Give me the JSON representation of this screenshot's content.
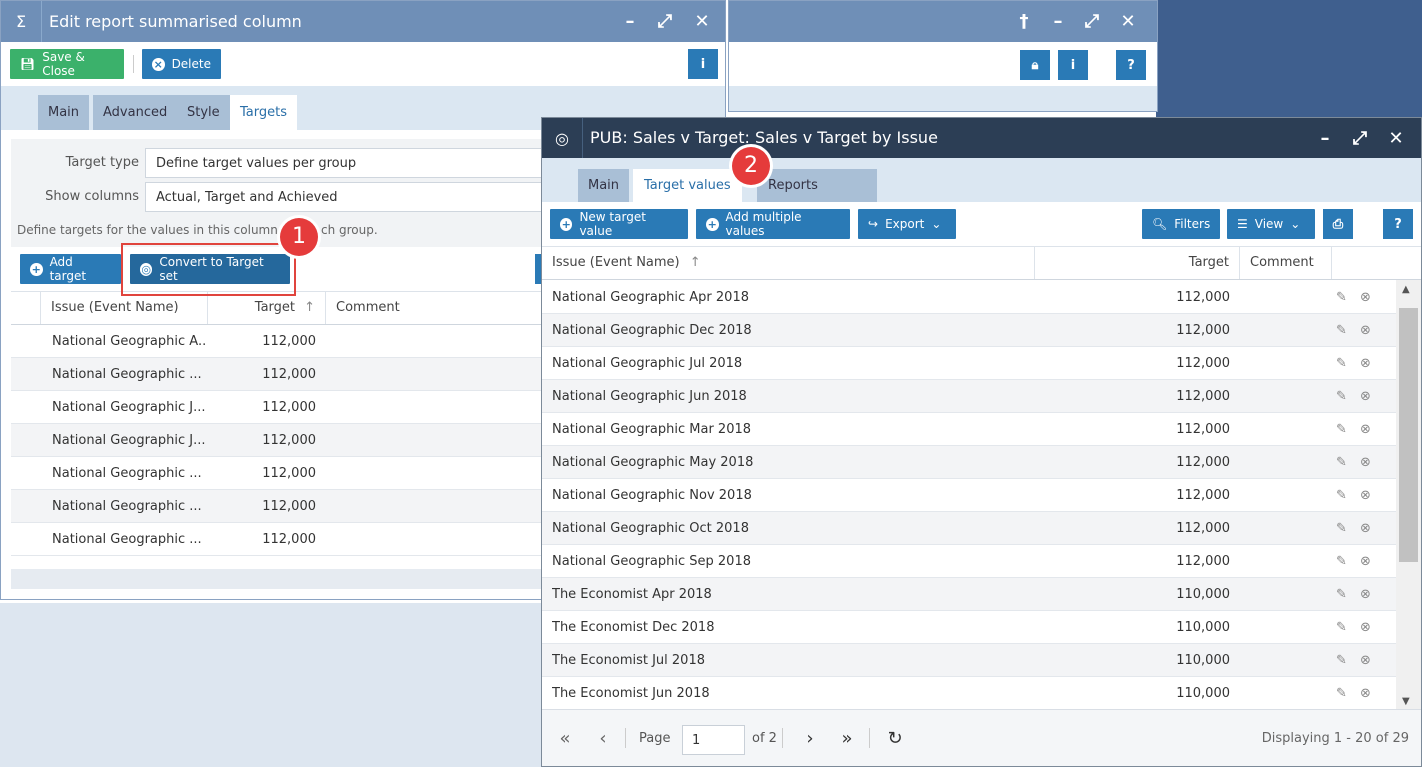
{
  "editor": {
    "title": "Edit report summarised column",
    "save_label": "Save & Close",
    "delete_label": "Delete",
    "tabs": [
      "Main",
      "Advanced",
      "Style",
      "Targets"
    ],
    "active_tab": "Targets",
    "target_type_label": "Target type",
    "target_type_value": "Define target values per group",
    "show_columns_label": "Show columns",
    "show_columns_value": "Actual, Target and Achieved",
    "hint": "Define targets for the values in this column wi",
    "hint_tail": "ch group.",
    "add_target_label": "Add target",
    "convert_label": "Convert to Target set",
    "columns": [
      "Issue (Event Name)",
      "Target",
      "Comment"
    ],
    "rows": [
      {
        "issue": "National Geographic A...",
        "target": "112,000"
      },
      {
        "issue": "National Geographic ...",
        "target": "112,000"
      },
      {
        "issue": "National Geographic J...",
        "target": "112,000"
      },
      {
        "issue": "National Geographic J...",
        "target": "112,000"
      },
      {
        "issue": "National Geographic ...",
        "target": "112,000"
      },
      {
        "issue": "National Geographic ...",
        "target": "112,000"
      },
      {
        "issue": "National Geographic ...",
        "target": "112,000"
      }
    ]
  },
  "targets": {
    "title": "PUB: Sales v Target: Sales v Target by Issue",
    "tabs": [
      "Main",
      "Target values",
      "Reports"
    ],
    "active_tab": "Target values",
    "new_label": "New target value",
    "add_multiple_label": "Add multiple values",
    "export_label": "Export",
    "filters_label": "Filters",
    "view_label": "View",
    "columns": [
      "Issue (Event Name)",
      "Target",
      "Comment"
    ],
    "rows": [
      {
        "issue": "National Geographic Apr 2018",
        "target": "112,000"
      },
      {
        "issue": "National Geographic Dec 2018",
        "target": "112,000"
      },
      {
        "issue": "National Geographic Jul 2018",
        "target": "112,000"
      },
      {
        "issue": "National Geographic Jun 2018",
        "target": "112,000"
      },
      {
        "issue": "National Geographic Mar 2018",
        "target": "112,000"
      },
      {
        "issue": "National Geographic May 2018",
        "target": "112,000"
      },
      {
        "issue": "National Geographic Nov 2018",
        "target": "112,000"
      },
      {
        "issue": "National Geographic Oct 2018",
        "target": "112,000"
      },
      {
        "issue": "National Geographic Sep 2018",
        "target": "112,000"
      },
      {
        "issue": "The Economist Apr 2018",
        "target": "110,000"
      },
      {
        "issue": "The Economist Dec 2018",
        "target": "110,000"
      },
      {
        "issue": "The Economist Jul 2018",
        "target": "110,000"
      },
      {
        "issue": "The Economist Jun 2018",
        "target": "110,000"
      }
    ],
    "pager": {
      "page_label": "Page",
      "page_value": "1",
      "of_label": "of 2",
      "displaying": "Displaying 1 - 20 of 29"
    }
  },
  "callouts": {
    "one": "1",
    "two": "2"
  },
  "colors": {
    "accent": "#2a7ab6",
    "save": "#3bb16b",
    "callout": "#e53b3b",
    "title_dark": "#2c3e55",
    "title_light": "#6f8fb7"
  }
}
